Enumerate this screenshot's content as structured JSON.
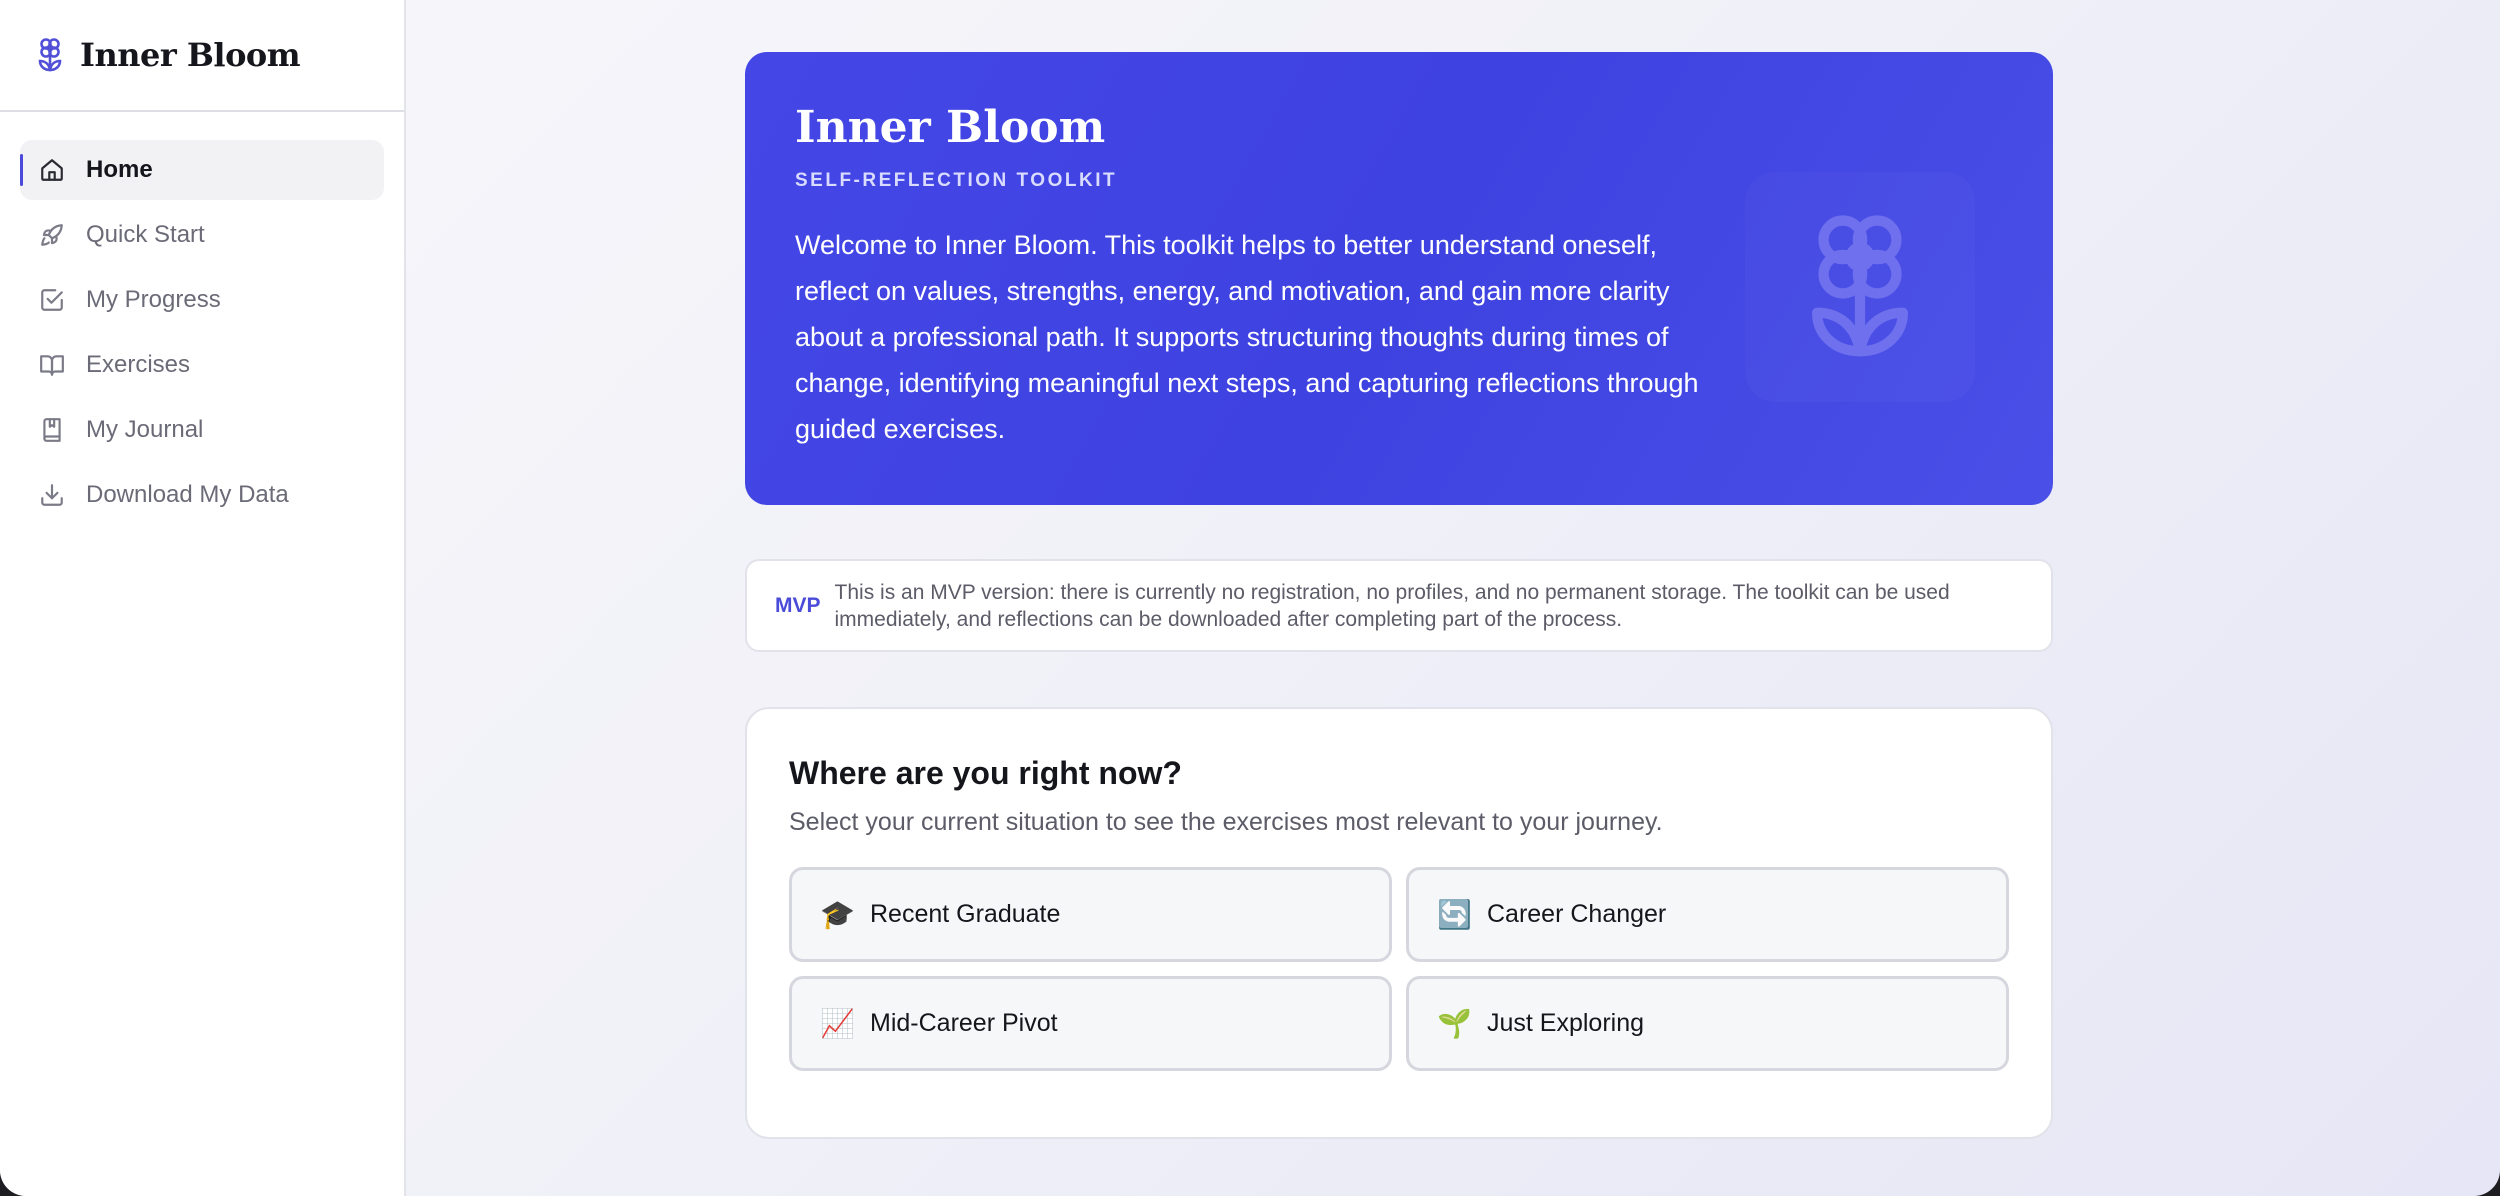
{
  "app": {
    "name": "Inner Bloom",
    "accent_color": "#4447e6"
  },
  "sidebar": {
    "items": [
      {
        "label": "Home",
        "icon": "home-icon",
        "active": true
      },
      {
        "label": "Quick Start",
        "icon": "rocket-icon",
        "active": false
      },
      {
        "label": "My Progress",
        "icon": "check-square-icon",
        "active": false
      },
      {
        "label": "Exercises",
        "icon": "open-book-icon",
        "active": false
      },
      {
        "label": "My Journal",
        "icon": "journal-icon",
        "active": false
      },
      {
        "label": "Download My Data",
        "icon": "download-icon",
        "active": false
      }
    ]
  },
  "hero": {
    "title": "Inner Bloom",
    "subtitle": "SELF-REFLECTION TOOLKIT",
    "text": "Welcome to Inner Bloom. This toolkit helps to better understand oneself, reflect on values, strengths, energy, and motivation, and gain more clarity about a professional path. It supports structuring thoughts during times of change, identifying meaningful next steps, and capturing reflections through guided exercises.",
    "icon": "flower-icon"
  },
  "notice": {
    "tag": "MVP",
    "text": "This is an MVP version: there is currently no registration, no profiles, and no permanent storage. The toolkit can be used immediately, and reflections can be downloaded after completing part of the process."
  },
  "situation": {
    "title": "Where are you right now?",
    "subtitle": "Select your current situation to see the exercises most relevant to your journey.",
    "options": [
      {
        "emoji": "🎓",
        "label": "Recent Graduate"
      },
      {
        "emoji": "🔄",
        "label": "Career Changer"
      },
      {
        "emoji": "📈",
        "label": "Mid-Career Pivot"
      },
      {
        "emoji": "🌱",
        "label": "Just Exploring"
      }
    ]
  }
}
